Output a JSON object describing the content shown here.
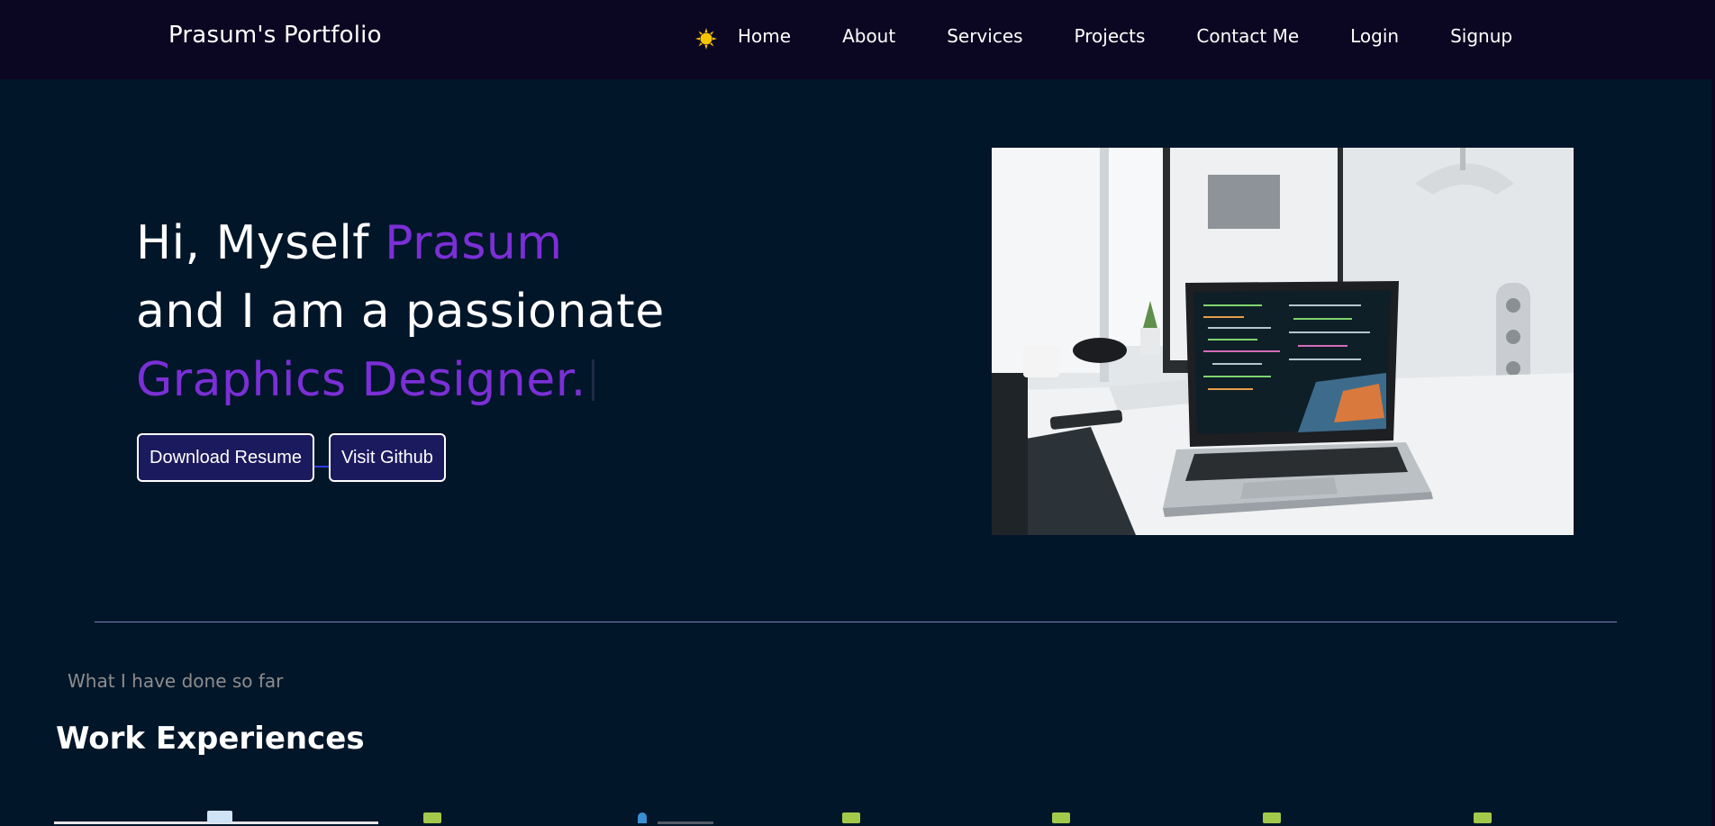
{
  "navbar": {
    "brand": "Prasum's Portfolio",
    "theme_icon": "sun-icon",
    "links": [
      {
        "label": "Home"
      },
      {
        "label": "About"
      },
      {
        "label": "Services"
      },
      {
        "label": "Projects"
      },
      {
        "label": "Contact Me"
      },
      {
        "label": "Login"
      },
      {
        "label": "Signup"
      }
    ]
  },
  "hero": {
    "line1_prefix": "Hi, Myself ",
    "line1_name": "Prasum",
    "line2": "and I am a passionate",
    "line3": "Graphics Designer.",
    "buttons": {
      "download_resume": "Download Resume",
      "visit_github": "Visit Github"
    },
    "image_alt": "laptop on desk with monitor"
  },
  "experience": {
    "subtitle": "What I have done so far",
    "title": "Work Experiences"
  },
  "colors": {
    "background": "#021629",
    "navbar": "#0b0722",
    "accent": "#7b2fd6",
    "button_bg": "#1c1a5e"
  }
}
